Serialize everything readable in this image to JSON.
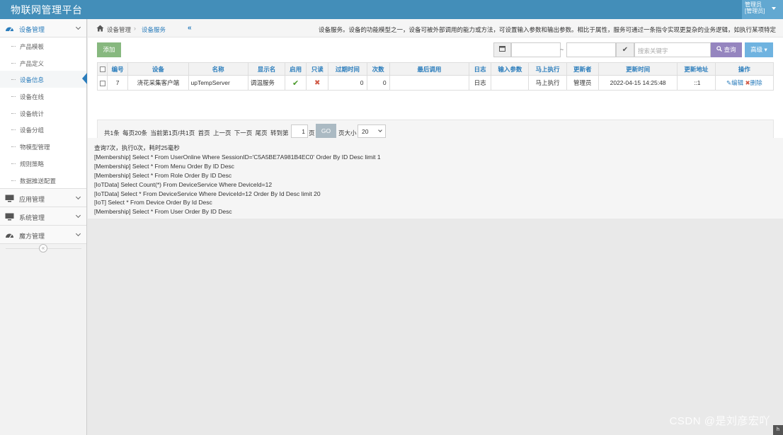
{
  "app": {
    "title": "物联网管理平台"
  },
  "user": {
    "line1": "管理员",
    "line2": "[管理员]"
  },
  "sidebar": {
    "groups": [
      {
        "label": "设备管理",
        "icon": "dashboard-icon",
        "expanded": true,
        "items": [
          {
            "label": "产品模板"
          },
          {
            "label": "产品定义"
          },
          {
            "label": "设备信息",
            "active": true
          },
          {
            "label": "设备在线"
          },
          {
            "label": "设备统计"
          },
          {
            "label": "设备分组"
          },
          {
            "label": "物模型管理"
          },
          {
            "label": "规则策略"
          },
          {
            "label": "数据推送配置"
          }
        ]
      },
      {
        "label": "应用管理",
        "icon": "desktop-icon"
      },
      {
        "label": "系统管理",
        "icon": "desktop-icon"
      },
      {
        "label": "魔方管理",
        "icon": "dashboard-icon"
      }
    ],
    "collapse_glyph": "«"
  },
  "breadcrumb": {
    "root": "设备管理",
    "current": "设备服务",
    "description": "设备服务。设备的功能模型之一，设备可被外部调用的能力或方法，可设置输入参数和输出参数。相比于属性，服务可通过一条指令实现更复杂的业务逻辑，如执行某项特定..."
  },
  "toolbar": {
    "add_label": "添加",
    "search_placeholder": "搜索关键字",
    "query_label": "查询",
    "advanced_label": "高级"
  },
  "table": {
    "columns": [
      "编号",
      "设备",
      "名称",
      "显示名",
      "启用",
      "只读",
      "过期时间",
      "次数",
      "最后调用",
      "日志",
      "输入参数",
      "马上执行",
      "更新者",
      "更新时间",
      "更新地址",
      "操作"
    ],
    "rows": [
      {
        "id": "7",
        "device": "浇花采集客户端",
        "name": "upTempServer",
        "display": "调温服务",
        "enabled": true,
        "readonly": false,
        "expire": "0",
        "count": "0",
        "last_call": "",
        "log": "日志",
        "input": "",
        "execute": "马上执行",
        "updater": "管理员",
        "update_time": "2022-04-15 14:25:48",
        "update_addr": "::1",
        "edit": "编辑",
        "delete": "删除"
      }
    ]
  },
  "pager": {
    "summary": "共1条 每页20条 当前第1页/共1页 首页 上一页 下一页 尾页 转到第",
    "page_value": "1",
    "page_suffix": "页",
    "go_label": "GO",
    "size_label": "页大小",
    "size_value": "20"
  },
  "log": {
    "lines": [
      "查询7次，执行0次，耗时25毫秒",
      "[Membership] Select * From UserOnline Where SessionID='C5A5BE7A981B4EC0' Order By ID Desc limit 1",
      "[Membership] Select * From Menu Order By ID Desc",
      "[Membership] Select * From Role Order By ID Desc",
      "[IoTData] Select Count(*) From DeviceService Where DeviceId=12",
      "[IoTData] Select * From DeviceService Where DeviceId=12 Order By Id Desc limit 20",
      "[IoT] Select * From Device Order By Id Desc",
      "[Membership] Select * From User Order By ID Desc"
    ]
  },
  "watermark": "CSDN @是刘彦宏吖",
  "colors": {
    "navbar": "#438eb9",
    "accent": "#2b7dbc",
    "add": "#87b87f",
    "query": "#9585bf",
    "advanced": "#6fb3e0"
  }
}
